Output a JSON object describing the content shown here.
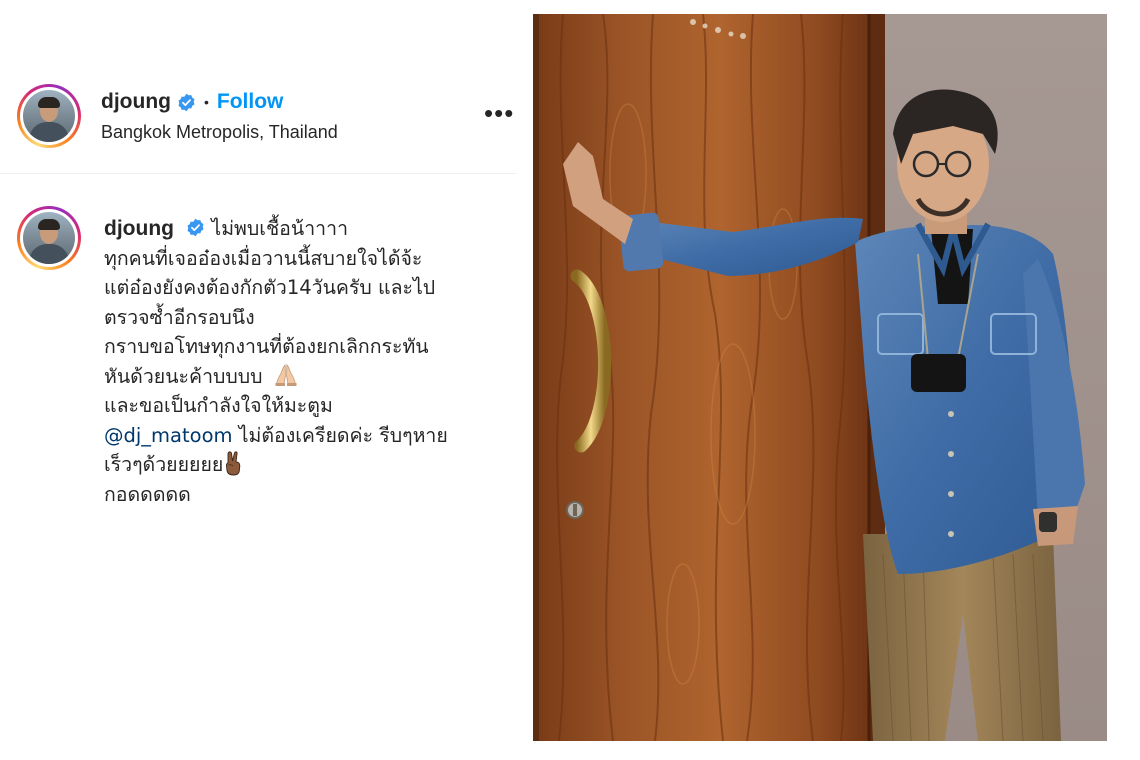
{
  "post": {
    "username": "djoung",
    "follow_label": "Follow",
    "separator": "•",
    "location": "Bangkok Metropolis, Thailand",
    "more_label": "•••",
    "verified_color": "#3897f0"
  },
  "caption": {
    "username": "djoung",
    "line1": "ไม่พบเชื้อน้าาาา",
    "line2": "ทุกคนที่เจออ๋องเมื่อวานนี้สบายใจได้จ้ะ",
    "line3": "แต่อ๋องยังคงต้องกักตัว14วันครับ และไป",
    "line4": "ตรวจซ้ำอีกรอบนึง",
    "line5": "กราบขอโทษทุกงานที่ต้องยกเลิกกระทัน",
    "line6": "หันด้วยนะค้าบบบบ",
    "line7": "และขอเป็นกำลังใจให้มะตูม",
    "mention": "@dj_matoom",
    "line8_rest": " ไม่ต้องเครียดค่ะ รีบๆหาย",
    "line9": "เร็วๆด้วยยยยย",
    "line10": "กอดดดดด",
    "emoji_pray": "pray-emoji",
    "emoji_peace": "victory-hand-emoji",
    "mention_color": "#00376b"
  },
  "image": {
    "subject": "man-in-denim-shirt-by-wooden-door"
  },
  "colors": {
    "follow": "#0095f6",
    "text": "#262626",
    "divider": "#efefef"
  }
}
